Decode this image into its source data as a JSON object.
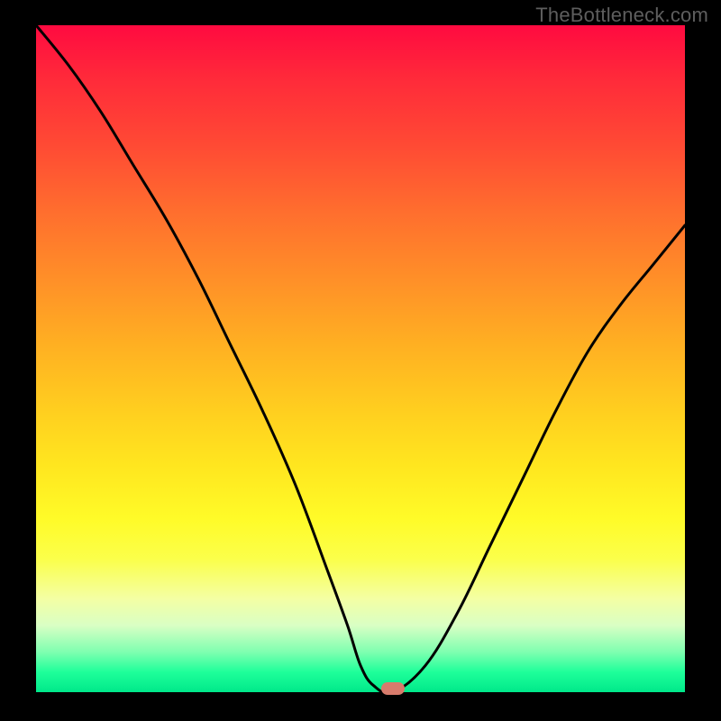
{
  "watermark": "TheBottleneck.com",
  "chart_data": {
    "type": "line",
    "title": "",
    "xlabel": "",
    "ylabel": "",
    "xlim": [
      0,
      100
    ],
    "ylim": [
      0,
      100
    ],
    "series": [
      {
        "name": "curve",
        "x": [
          0,
          5,
          10,
          15,
          20,
          25,
          30,
          35,
          40,
          45,
          48,
          50,
          52,
          55,
          60,
          65,
          70,
          75,
          80,
          85,
          90,
          95,
          100
        ],
        "values": [
          100,
          94,
          87,
          79,
          71,
          62,
          52,
          42,
          31,
          18,
          10,
          4,
          1,
          0,
          4,
          12,
          22,
          32,
          42,
          51,
          58,
          64,
          70
        ]
      }
    ],
    "marker": {
      "x": 55,
      "y": 0,
      "color": "#d87b6c"
    },
    "gradient_stops": [
      {
        "pos": 0,
        "color": "#ff0a40"
      },
      {
        "pos": 50,
        "color": "#ffcf1f"
      },
      {
        "pos": 80,
        "color": "#fbff4a"
      },
      {
        "pos": 100,
        "color": "#00e88a"
      }
    ]
  }
}
